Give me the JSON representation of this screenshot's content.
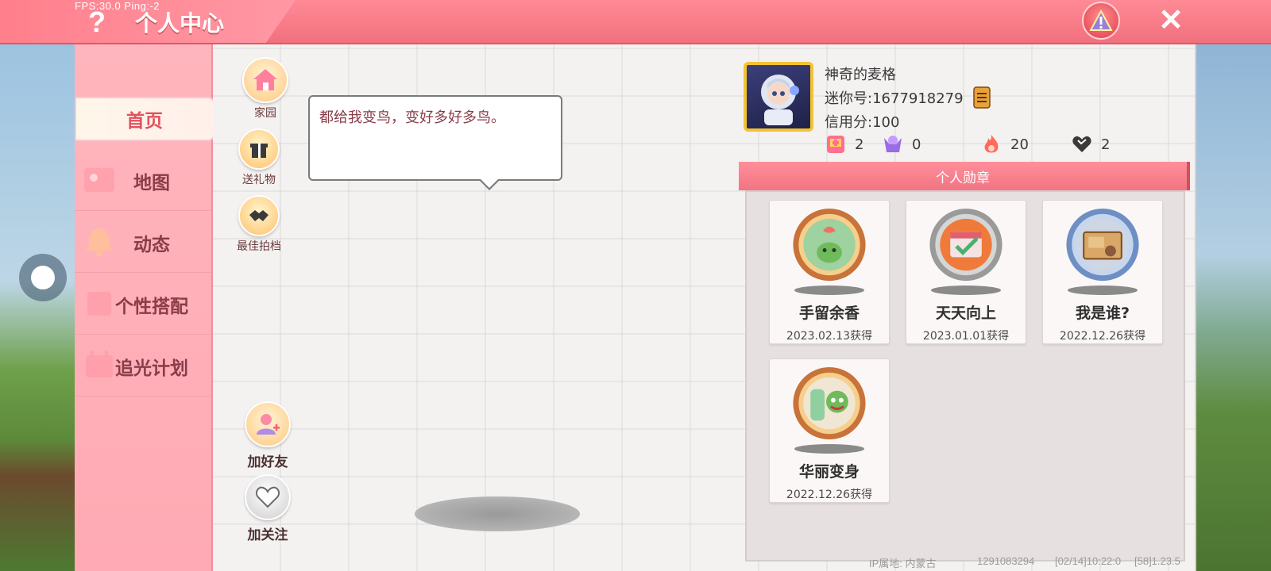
{
  "header": {
    "fps_text": "FPS:30.0  Ping:-2",
    "title": "个人中心",
    "help_icon": "?",
    "close_icon": "✕"
  },
  "sidebar": {
    "items": [
      {
        "label": "首页",
        "icon": "home-icon",
        "active": true
      },
      {
        "label": "地图",
        "icon": "map-icon"
      },
      {
        "label": "动态",
        "icon": "bell-icon"
      },
      {
        "label": "个性搭配",
        "icon": "outfit-icon"
      },
      {
        "label": "追光计划",
        "icon": "plan-icon"
      }
    ]
  },
  "actions": {
    "home": "家园",
    "gift": "送礼物",
    "partner": "最佳拍档",
    "add_friend": "加好友",
    "follow": "加关注"
  },
  "bubble": {
    "text": "都给我变鸟，变好多好多鸟。"
  },
  "profile": {
    "name": "神奇的麦格",
    "mini_id": "迷你号:1677918279",
    "credit": "信用分:100",
    "stats": [
      {
        "icon": "badge-plus-icon",
        "value": "2"
      },
      {
        "icon": "cheer-icon",
        "value": "0"
      },
      {
        "icon": "flame-icon",
        "value": "20"
      },
      {
        "icon": "heart-icon",
        "value": "2"
      }
    ]
  },
  "medals": {
    "header": "个人勋章",
    "items": [
      {
        "name": "手留余香",
        "date": "2023.02.13获得",
        "ring": "#c8733a",
        "inner": "#9ed2a0"
      },
      {
        "name": "天天向上",
        "date": "2023.01.01获得",
        "ring": "#a8a8a8",
        "inner": "#f07a3a"
      },
      {
        "name": "我是谁?",
        "date": "2022.12.26获得",
        "ring": "#6d8fc4",
        "inner": "#d9a868"
      },
      {
        "name": "华丽变身",
        "date": "2022.12.26获得",
        "ring": "#c8733a",
        "inner": "#8fcfa0"
      }
    ]
  },
  "footer": {
    "ip": "IP属地: 内蒙古",
    "uid": "1291083294",
    "time": "[02/14]10:22:0",
    "build": "[58]1.23.5"
  },
  "colors": {
    "accent": "#f27482",
    "sidebar_bg": "#ffb0b9",
    "active_text": "#e1525f"
  }
}
